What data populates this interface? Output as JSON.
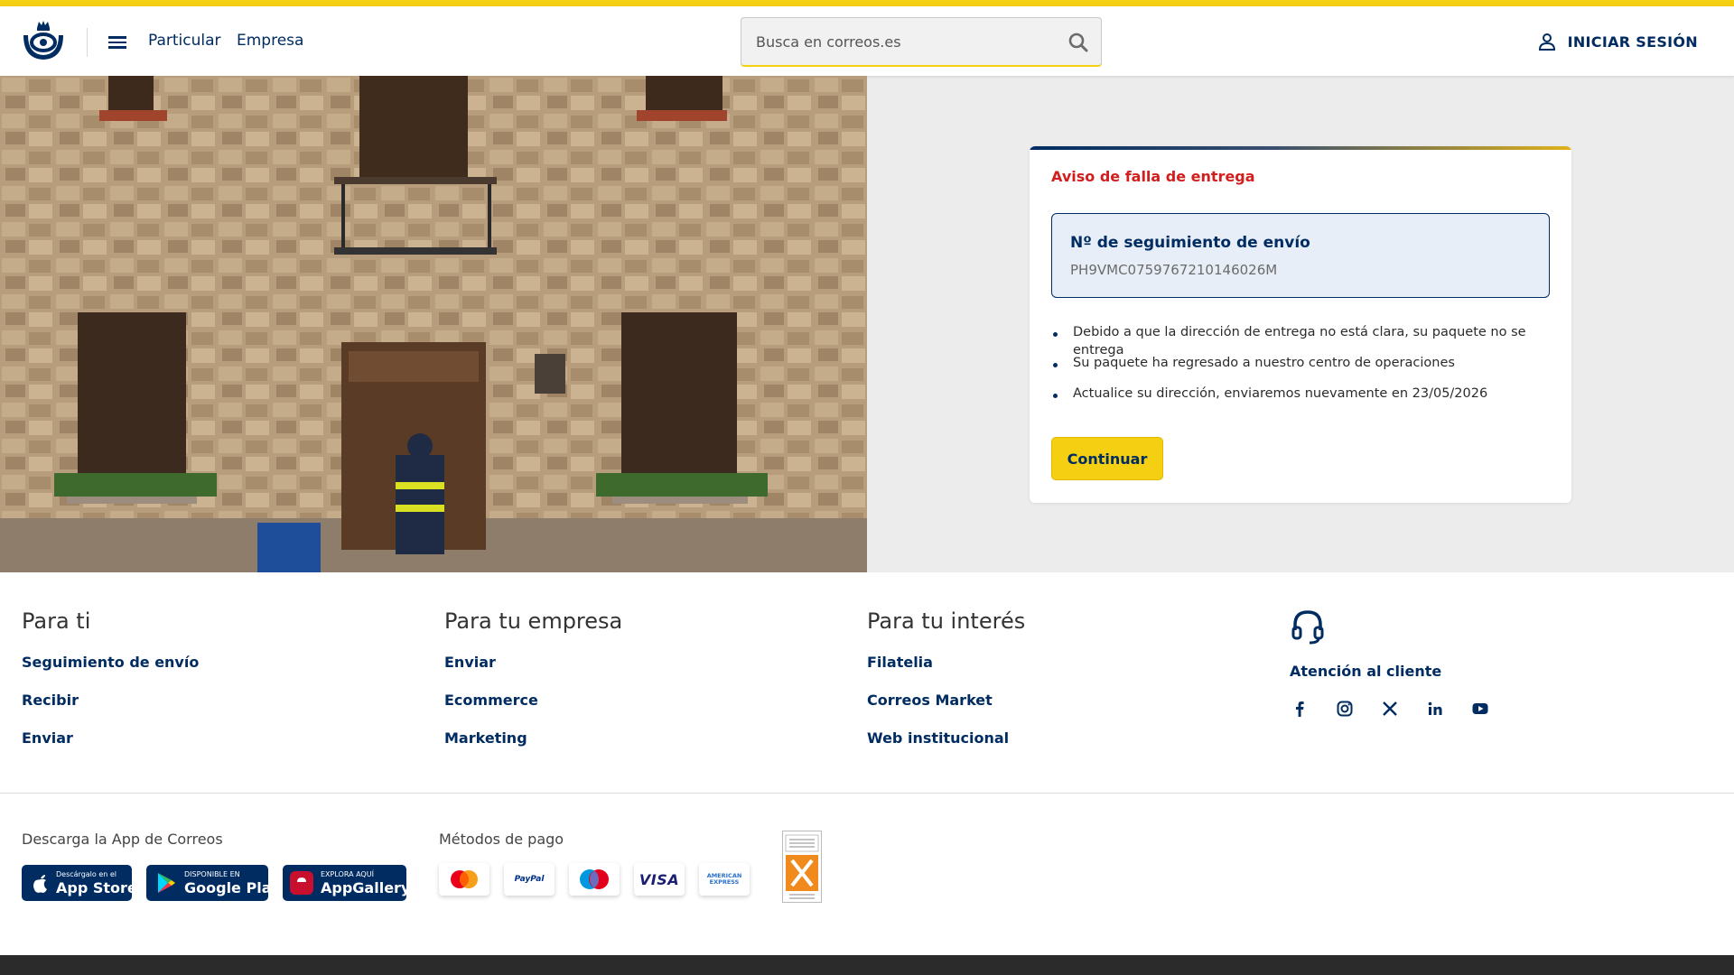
{
  "header": {
    "nav": {
      "particular": "Particular",
      "empresa": "Empresa"
    },
    "search": {
      "placeholder": "Busca en correos.es"
    },
    "login_label": "INICIAR SESIÓN"
  },
  "notice": {
    "title": "Aviso de falla de entrega",
    "tracking_label": "Nº de seguimiento de envío",
    "tracking_number": "PH9VMC0759767210146026M",
    "messages": [
      "Debido a que la dirección de entrega no está clara, su paquete no se entrega",
      "Su paquete ha regresado a nuestro centro de operaciones",
      "Actualice su dirección, enviaremos nuevamente en 23/05/2026"
    ],
    "button_label": "Continuar"
  },
  "footer": {
    "col1": {
      "heading": "Para ti",
      "links": [
        "Seguimiento de envío",
        "Recibir",
        "Enviar"
      ]
    },
    "col2": {
      "heading": "Para tu empresa",
      "links": [
        "Enviar",
        "Ecommerce",
        "Marketing"
      ]
    },
    "col3": {
      "heading": "Para tu interés",
      "links": [
        "Filatelia",
        "Correos Market",
        "Web institucional"
      ]
    },
    "support_label": "Atención al cliente",
    "socials": [
      "facebook-icon",
      "instagram-icon",
      "x-icon",
      "linkedin-icon",
      "youtube-icon"
    ],
    "app_label": "Descarga la App de Correos",
    "app_badges": {
      "appstore": {
        "small": "Descárgalo en el",
        "big": "App Store"
      },
      "googleplay": {
        "small": "DISPONIBLE EN",
        "big": "Google Play"
      },
      "appgallery": {
        "small": "EXPLORA AQUÍ",
        "big": "AppGallery"
      }
    },
    "payment_label": "Métodos de pago",
    "payments": {
      "paypal": "PayPal",
      "maestro": "Maestro",
      "visa": "VISA",
      "amex": "AMERICAN EXPRESS"
    }
  },
  "colors": {
    "brand_yellow": "#f5cf11",
    "brand_blue": "#002c61",
    "alert_red": "#d31e1e"
  }
}
